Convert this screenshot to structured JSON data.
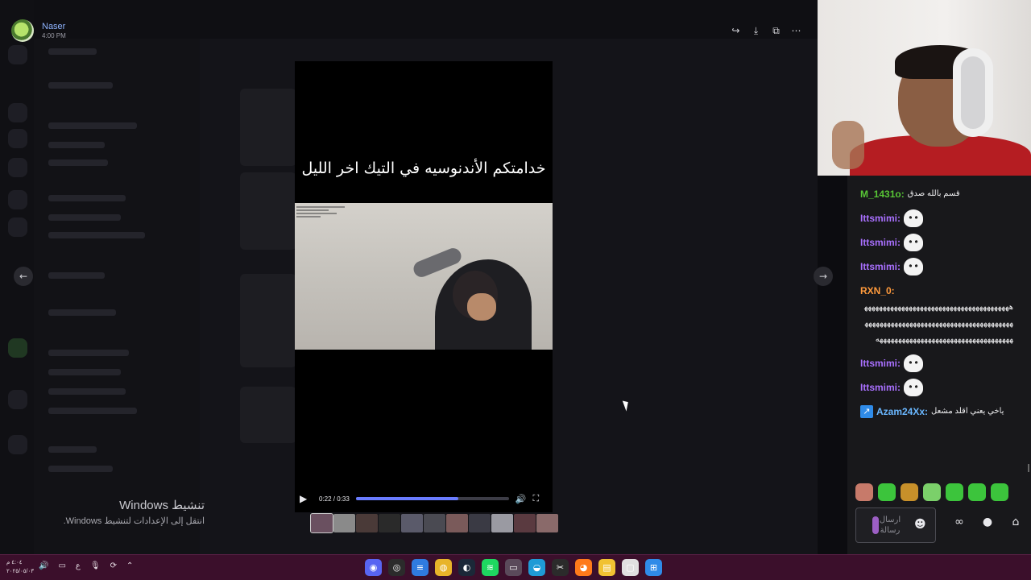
{
  "viewer": {
    "username": "Naser",
    "time": "4:00 PM",
    "actions": [
      {
        "name": "forward-icon",
        "glyph": "↪"
      },
      {
        "name": "download-icon",
        "glyph": "⤓"
      },
      {
        "name": "open-external-icon",
        "glyph": "⧉"
      },
      {
        "name": "more-icon",
        "glyph": "⋯"
      }
    ],
    "prev_glyph": "←",
    "next_glyph": "→"
  },
  "video": {
    "caption": "خدامتكم الأندنوسيه في التيك اخر الليل",
    "time": "0:22 / 0:33",
    "progress": 0.67,
    "play_glyph": "▶",
    "volume_glyph": "🔊",
    "fullscreen_glyph": "⛶",
    "thumbnail_colors": [
      "#6a5060",
      "#8a8a8a",
      "#4a3a38",
      "#2a2a2a",
      "#5a5a6a",
      "#4a4a52",
      "#7a5a5a",
      "#3a3a44",
      "#9a9aa2",
      "#5a3a40",
      "#8a6a6a"
    ]
  },
  "watermark": {
    "title": "تنشيط Windows",
    "subtitle": "انتقل إلى الإعدادات لتنشيط Windows."
  },
  "chat": {
    "messages": [
      {
        "user": "M_1431o",
        "color": "#58c736",
        "text": "قسم بالله صدق"
      },
      {
        "user": "Ittsmimi",
        "color": "#a970ff",
        "emote": true
      },
      {
        "user": "Ittsmimi",
        "color": "#a970ff",
        "emote": true
      },
      {
        "user": "Ittsmimi",
        "color": "#a970ff",
        "emote": true
      },
      {
        "user": "RXN_0",
        "color": "#ff9a3c",
        "text": "ههههههههههههههههههههههههههههههههههههههههههههههههههههههههههههههههههههههههههههههههههههههههههههههههههههههههههههههههههههه"
      },
      {
        "user": "Ittsmimi",
        "color": "#a970ff",
        "emote": true
      },
      {
        "user": "Ittsmimi",
        "color": "#a970ff",
        "emote": true
      },
      {
        "user": "Azam24Xx",
        "color": "#6ab7ff",
        "badge": true,
        "text": "ياخي يعني اقلد مشعل"
      }
    ],
    "emote_colors": [
      "#c77a6a",
      "#3cc43c",
      "#c8902a",
      "#7bd06a",
      "#3cc43c",
      "#3cc43c",
      "#3cc43c"
    ],
    "input_placeholder": "ارسال رسالة",
    "smile_glyph": "☻",
    "icons": [
      {
        "name": "infinity-icon",
        "glyph": "∞"
      },
      {
        "name": "points-icon",
        "glyph": "●"
      },
      {
        "name": "store-icon",
        "glyph": "⌂"
      }
    ]
  },
  "taskbar": {
    "time": "٤:٠٤ م",
    "date": "٢٠٢٥/٠٥/٠٣",
    "lang": "ع",
    "tray": [
      "🔊",
      "▭",
      "ع",
      "🎙",
      "⟳",
      "⌃"
    ],
    "apps": [
      {
        "name": "discord-icon",
        "color": "#5865f2",
        "glyph": "◉"
      },
      {
        "name": "obs-icon",
        "color": "#2b2b2b",
        "glyph": "◎"
      },
      {
        "name": "notepad-icon",
        "color": "#2f7be0",
        "glyph": "≡"
      },
      {
        "name": "chrome-icon",
        "color": "#e8b429",
        "glyph": "◍"
      },
      {
        "name": "steam-icon",
        "color": "#1b2838",
        "glyph": "◐"
      },
      {
        "name": "spotify-icon",
        "color": "#1ed760",
        "glyph": "≋"
      },
      {
        "name": "app-icon",
        "color": "#5a4a5a",
        "glyph": "▭"
      },
      {
        "name": "edge-icon",
        "color": "#1f9bd6",
        "glyph": "◒"
      },
      {
        "name": "capcut-icon",
        "color": "#2b2b2b",
        "glyph": "✂"
      },
      {
        "name": "firefox-icon",
        "color": "#ff7a1a",
        "glyph": "◕"
      },
      {
        "name": "explorer-icon",
        "color": "#f1c232",
        "glyph": "▤"
      },
      {
        "name": "window-icon",
        "color": "#e0e0e0",
        "glyph": "▢"
      },
      {
        "name": "windows-icon",
        "color": "#2f8be8",
        "glyph": "⊞"
      }
    ]
  }
}
